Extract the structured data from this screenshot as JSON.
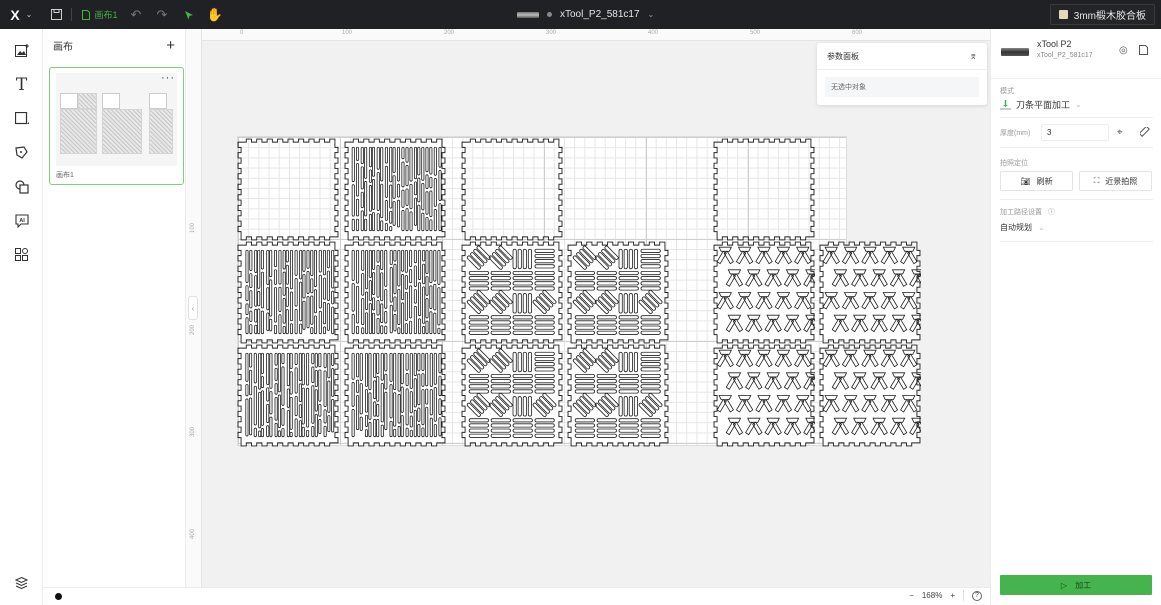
{
  "topbar": {
    "logo": "X",
    "canvas_tab_label": "画布1",
    "device_title": "xTool_P2_581c17",
    "material_label": "3mm椴木胶合板",
    "accent_color": "#3fb43f"
  },
  "leftbar": {
    "tools": [
      {
        "name": "image-upload-icon",
        "glyph": "🖼"
      },
      {
        "name": "text-tool-icon",
        "glyph": "T"
      },
      {
        "name": "shape-tool-icon",
        "glyph": "□"
      },
      {
        "name": "pen-tool-icon",
        "glyph": "✎"
      },
      {
        "name": "shapes-library-icon",
        "glyph": "⧉"
      },
      {
        "name": "ai-tool-icon",
        "glyph": "AI"
      },
      {
        "name": "apps-icon",
        "glyph": "⁘"
      }
    ],
    "layers_icon": "layers-icon"
  },
  "canvas_panel": {
    "title": "画布",
    "add_label": "+",
    "canvases": [
      {
        "name": "画布1",
        "more": "···"
      }
    ]
  },
  "rulers": {
    "top_labels": [
      "0",
      "100",
      "200",
      "300",
      "400",
      "500",
      "600"
    ],
    "left_labels": [
      "100",
      "200",
      "300",
      "400"
    ]
  },
  "param_panel": {
    "title": "参数面板",
    "empty_text": "无选中对象"
  },
  "right_panel": {
    "device_name": "xTool P2",
    "device_id": "xTool_P2_581c17",
    "mode_label": "模式",
    "mode_value": "刀条平面加工",
    "thickness_label": "厚度(mm)",
    "thickness_value": "3",
    "camera_label": "拍照定位",
    "refresh_label": "刷新",
    "closeup_label": "近景拍照",
    "path_label": "加工路径设置",
    "path_value": "自动规划",
    "process_label": "加工",
    "process_color": "#45b44c"
  },
  "bottombar": {
    "zoom_out": "−",
    "zoom_level": "168%",
    "zoom_in": "+",
    "help": "?"
  },
  "design": {
    "tiles": [
      {
        "col": 0,
        "row": 0,
        "pattern": "blank"
      },
      {
        "col": 1,
        "row": 0,
        "pattern": "organic"
      },
      {
        "col": 0,
        "row": 1,
        "pattern": "organic"
      },
      {
        "col": 1,
        "row": 1,
        "pattern": "organic"
      },
      {
        "col": 0,
        "row": 2,
        "pattern": "organic"
      },
      {
        "col": 1,
        "row": 2,
        "pattern": "organic"
      },
      {
        "col": 2,
        "row": 0,
        "pattern": "blank"
      },
      {
        "col": 2,
        "row": 1,
        "pattern": "basket"
      },
      {
        "col": 3,
        "row": 1,
        "pattern": "basket"
      },
      {
        "col": 2,
        "row": 2,
        "pattern": "basket"
      },
      {
        "col": 3,
        "row": 2,
        "pattern": "basket"
      },
      {
        "col": 4,
        "row": 0,
        "pattern": "blank"
      },
      {
        "col": 4,
        "row": 1,
        "pattern": "geometric"
      },
      {
        "col": 5,
        "row": 1,
        "pattern": "geometric"
      },
      {
        "col": 4,
        "row": 2,
        "pattern": "geometric"
      },
      {
        "col": 5,
        "row": 2,
        "pattern": "geometric"
      }
    ]
  }
}
